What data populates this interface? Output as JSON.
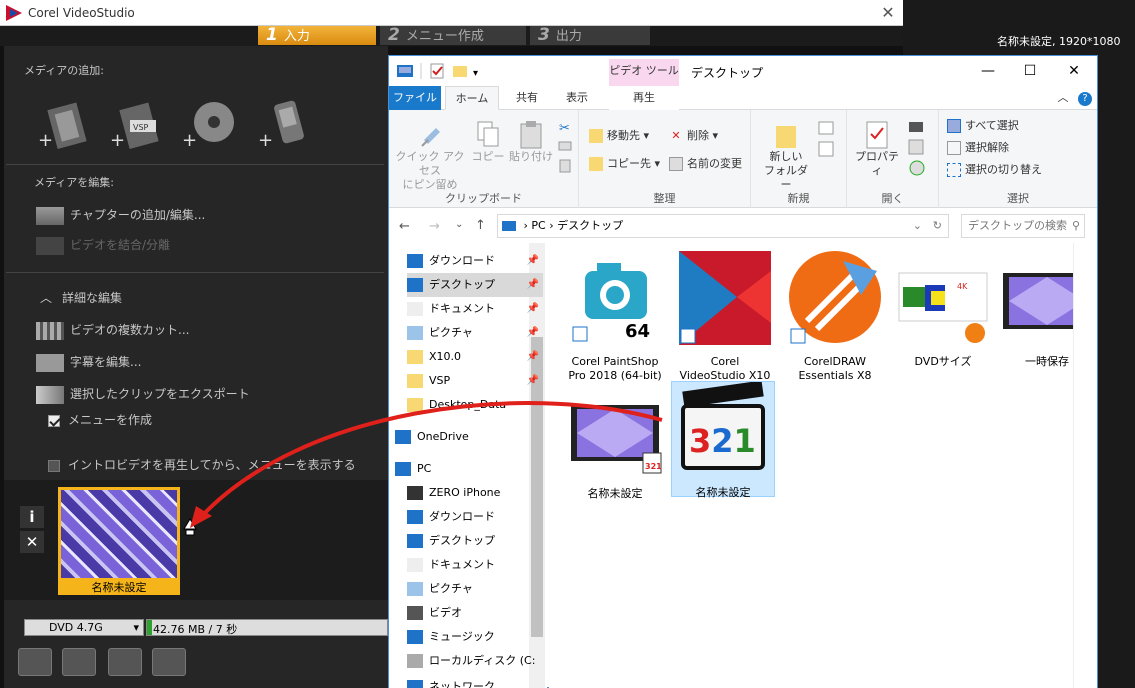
{
  "corel": {
    "title": "Corel VideoStudio",
    "close": "✕",
    "steps": [
      {
        "num": "1",
        "label": "入力"
      },
      {
        "num": "2",
        "label": "メニュー作成"
      },
      {
        "num": "3",
        "label": "出力"
      }
    ],
    "project_info": "名称未設定, 1920*1080",
    "add_media_title": "メディアの追加:",
    "edit_media_title": "メディアを編集:",
    "chapter": "チャプターの追加/編集...",
    "combine": "ビデオを結合/分離",
    "advanced": "詳細な編集",
    "multicut": "ビデオの複数カット...",
    "subtitle": "字幕を編集...",
    "export": "選択したクリップをエクスポート",
    "create_menu": "メニューを作成",
    "intro": "イントロビデオを再生してから、メニューを表示する",
    "thumb_label": "名称未設定",
    "info_btn": "i",
    "del_btn": "✕",
    "disc": "DVD 4.7G",
    "size": "42.76 MB / 7 秒",
    "size_fraction": 0.02
  },
  "explorer": {
    "context_tab": "ピデオ ツール",
    "context_sub": "再生",
    "title": "デスクトップ",
    "min": "—",
    "max": "☐",
    "close": "✕",
    "tabs": [
      "ファイル",
      "ホーム",
      "共有",
      "表示"
    ],
    "ribbon": {
      "clipboard": {
        "label": "クリップボード",
        "pin": "クイック アクセス\nにピン留め",
        "copy": "コピー",
        "paste": "貼り付け"
      },
      "organize": {
        "label": "整理",
        "move": "移動先",
        "copy_to": "コピー先",
        "delete": "削除",
        "rename": "名前の変更"
      },
      "new": {
        "label": "新規",
        "new_folder": "新しい\nフォルダー"
      },
      "open": {
        "label": "開く",
        "properties": "プロパティ"
      },
      "select": {
        "label": "選択",
        "select_all": "すべて選択",
        "select_none": "選択解除",
        "invert": "選択の切り替え"
      }
    },
    "address": [
      "PC",
      "デスクトップ"
    ],
    "search_placeholder": "デスクトップの検索",
    "nav": [
      {
        "label": "ダウンロード",
        "icon": "download-icon",
        "pin": true
      },
      {
        "label": "デスクトップ",
        "icon": "desktop-icon",
        "pin": true,
        "selected": true
      },
      {
        "label": "ドキュメント",
        "icon": "document-icon",
        "pin": true
      },
      {
        "label": "ピクチャ",
        "icon": "picture-icon",
        "pin": true
      },
      {
        "label": "X10.0",
        "icon": "folder-icon",
        "pin": true
      },
      {
        "label": "VSP",
        "icon": "folder-icon",
        "pin": true
      },
      {
        "label": "Desktop_Data",
        "icon": "folder-icon",
        "pin": false
      },
      {
        "label": "OneDrive",
        "icon": "cloud-icon",
        "pin": false
      },
      {
        "label": "PC",
        "icon": "pc-icon",
        "pin": false
      },
      {
        "label": "ZERO iPhone",
        "icon": "phone-icon",
        "pin": false
      },
      {
        "label": "ダウンロード",
        "icon": "download-icon",
        "pin": false
      },
      {
        "label": "デスクトップ",
        "icon": "desktop-icon",
        "pin": false
      },
      {
        "label": "ドキュメント",
        "icon": "document-icon",
        "pin": false
      },
      {
        "label": "ピクチャ",
        "icon": "picture-icon",
        "pin": false
      },
      {
        "label": "ビデオ",
        "icon": "video-icon",
        "pin": false
      },
      {
        "label": "ミュージック",
        "icon": "music-icon",
        "pin": false
      },
      {
        "label": "ローカルディスク (C:",
        "icon": "disk-icon",
        "pin": false
      },
      {
        "label": "ネットワーク",
        "icon": "network-icon",
        "pin": false
      }
    ],
    "files": [
      {
        "label": "Corel PaintShop\nPro 2018 (64-bit)",
        "icon": "paintshop-icon"
      },
      {
        "label": "Corel\nVideoStudio X10",
        "icon": "videostudio-icon"
      },
      {
        "label": "CorelDRAW\nEssentials X8",
        "icon": "coreldraw-icon"
      },
      {
        "label": "DVDサイズ",
        "icon": "dvd-size-image-icon"
      },
      {
        "label": "一時保存",
        "icon": "video-file-icon"
      },
      {
        "label": "名称未設定",
        "icon": "video-file-icon"
      },
      {
        "label": "名称未設定",
        "icon": "mpc-321-icon",
        "selected": true
      }
    ]
  }
}
